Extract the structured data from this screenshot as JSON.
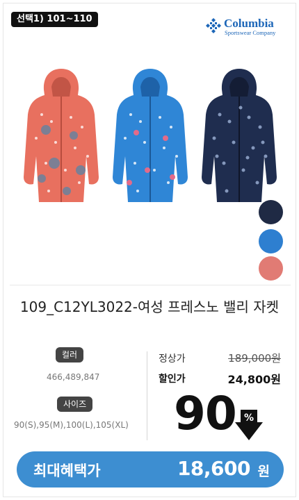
{
  "badge": {
    "label": "선택1) 101~110"
  },
  "brand": {
    "name": "Columbia",
    "tagline": "Sportswear Company",
    "color": "#1c66b8"
  },
  "product": {
    "title": "109_C12YL3022-여성 프레스노 밸리 자켓",
    "image_alt": "jackets-in-three-colors"
  },
  "swatches": [
    {
      "name": "navy",
      "color": "#1f2a44"
    },
    {
      "name": "blue",
      "color": "#2e7fd0"
    },
    {
      "name": "coral",
      "color": "#e17b74"
    }
  ],
  "info": {
    "color_label": "컬러",
    "color_value": "466,489,847",
    "size_label": "사이즈",
    "size_value": "90(S),95(M),100(L),105(XL)"
  },
  "price": {
    "regular_label": "정상가",
    "regular_value": "189,000원",
    "sale_label": "할인가",
    "sale_value": "24,800원",
    "discount": "90",
    "discount_unit": "%"
  },
  "benefit": {
    "label": "최대혜택가",
    "amount": "18,600",
    "unit": "원",
    "color": "#3d8ed1"
  }
}
